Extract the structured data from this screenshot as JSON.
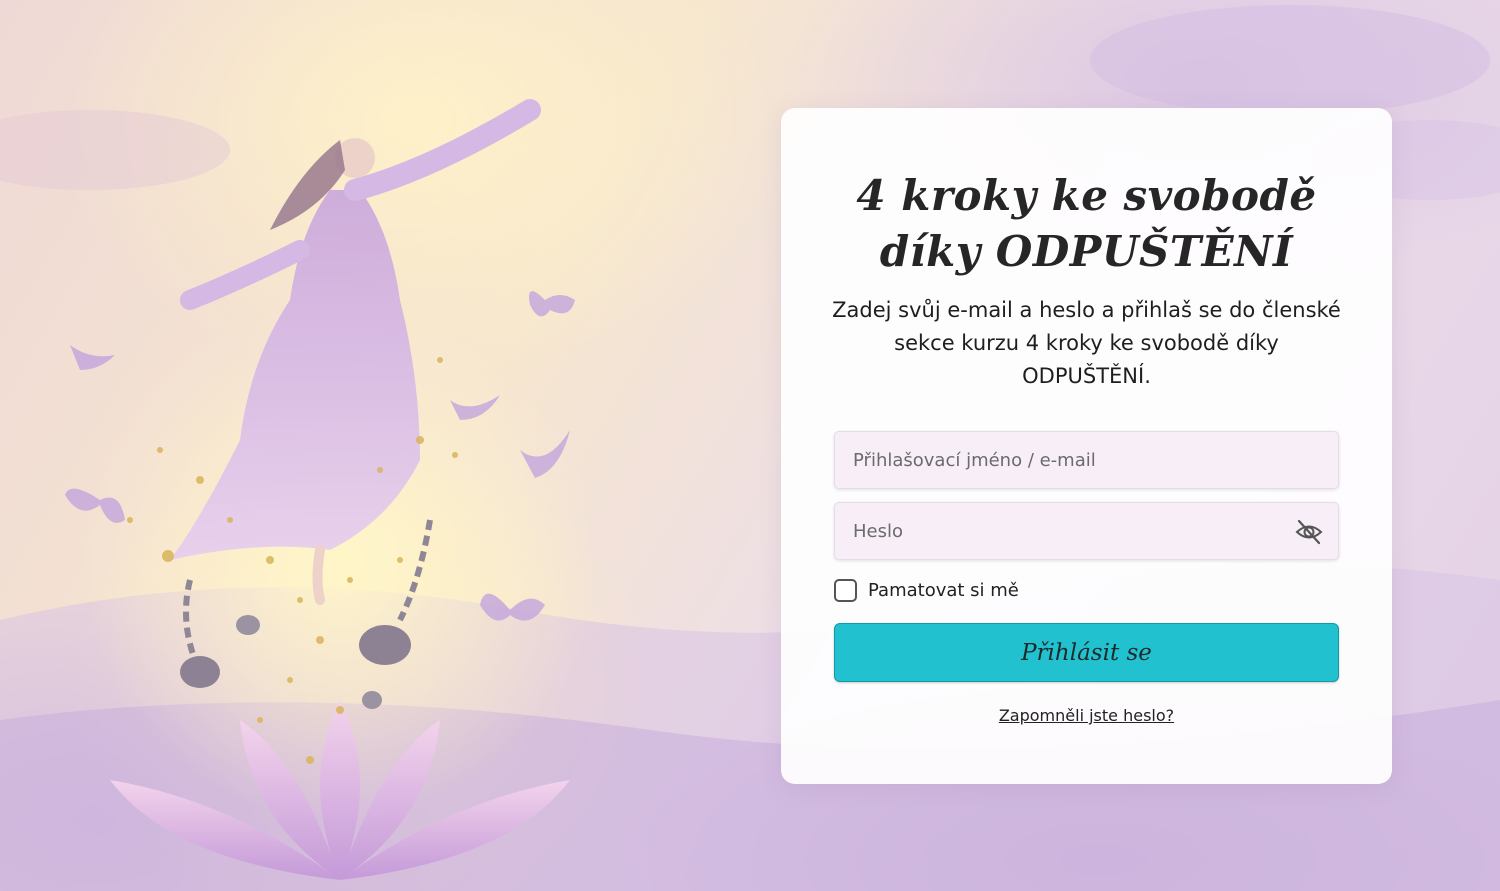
{
  "card": {
    "title_line1": "4 kroky ke svobodě",
    "title_line2": "díky ODPUŠTĚNÍ",
    "description": "Zadej svůj e-mail a heslo a přihlaš se do členské sekce kurzu 4 kroky ke svobodě díky ODPUŠTĚNÍ."
  },
  "form": {
    "username_placeholder": "Přihlašovací jméno / e-mail",
    "username_value": "",
    "password_placeholder": "Heslo",
    "password_value": "",
    "password_toggle_icon": "eye-slash-icon",
    "remember_label": "Pamatovat si mě",
    "remember_checked": false,
    "submit_label": "Přihlásit se",
    "forgot_link": "Zapomněli jste heslo?"
  },
  "colors": {
    "button": "#22c1d0",
    "field_background": "#f7eef8"
  }
}
